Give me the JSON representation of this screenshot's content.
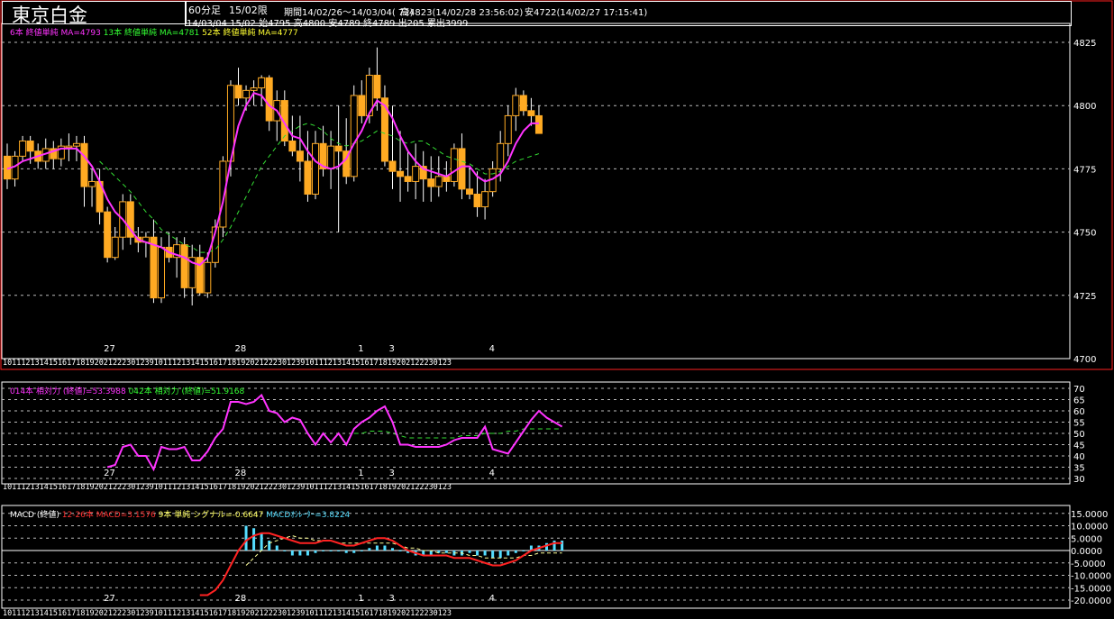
{
  "header": {
    "title": "東京白金",
    "period_tag": "60分足",
    "contract": "15/02限",
    "range": "期間14/02/26〜14/03/04( 72)",
    "high": "高4823(14/02/28 23:56:02)",
    "low": "安4722(14/02/27 17:15:41)",
    "last_bar": "14/03/04 15/02 始4795 高4800 安4789 終4789 出205 累出3999"
  },
  "legends": {
    "price": [
      {
        "text": "6本 終値単純 MA=4793",
        "color": "#ff33ff"
      },
      {
        "text": "13本 終値単純 MA=4781",
        "color": "#33ff33"
      },
      {
        "text": "52本 終値単純 MA=4777",
        "color": "#ffff33"
      }
    ],
    "rsi": [
      {
        "text": "014本 相対力 (終値)=53.3988",
        "color": "#ff33ff"
      },
      {
        "text": "042本 相対力 (終値)=51.9168",
        "color": "#33ff33"
      }
    ],
    "macd": [
      {
        "text": "MACD (終値)",
        "color": "#ffffff"
      },
      {
        "text": "12-26本 MACD=3.1576",
        "color": "#ff3333"
      },
      {
        "text": "9本 単純 シグナル=-0.6647",
        "color": "#ffff66"
      },
      {
        "text": "MACDｵｼﾚｰﾀｰ=3.8224",
        "color": "#55ddff"
      }
    ]
  },
  "axis": {
    "price_ticks": [
      "4825",
      "4800",
      "4775",
      "4750",
      "4725",
      "4700"
    ],
    "rsi_ticks": [
      "70",
      "65",
      "60",
      "55",
      "50",
      "45",
      "40",
      "35",
      "30"
    ],
    "macd_ticks": [
      "15.0000",
      "10.0000",
      "5.0000",
      "0.0000",
      "-5.0000",
      "-10.0000",
      "-15.0000",
      "-20.0000"
    ],
    "day_labels": [
      {
        "label": "27",
        "bar": 13
      },
      {
        "label": "28",
        "bar": 30
      },
      {
        "label": "1",
        "bar": 46
      },
      {
        "label": "3",
        "bar": 50
      },
      {
        "label": "4",
        "bar": 63
      }
    ],
    "hour_labels": [
      "1011121314151617181920212223",
      "0123910111213141516171819202122",
      "23012391011121314151617181920212223",
      "0123"
    ]
  },
  "chart_data": {
    "type": "candlestick",
    "price_ylim": [
      4700,
      4830
    ],
    "rsi_ylim": [
      30,
      70
    ],
    "macd_ylim": [
      -20,
      15
    ],
    "ohlc": [
      [
        4780,
        4785,
        4767,
        4771
      ],
      [
        4771,
        4782,
        4768,
        4780
      ],
      [
        4780,
        4788,
        4778,
        4786
      ],
      [
        4786,
        4788,
        4777,
        4782
      ],
      [
        4782,
        4785,
        4775,
        4778
      ],
      [
        4778,
        4787,
        4775,
        4783
      ],
      [
        4783,
        4786,
        4775,
        4779
      ],
      [
        4779,
        4787,
        4776,
        4784
      ],
      [
        4784,
        4789,
        4778,
        4784
      ],
      [
        4784,
        4788,
        4778,
        4785
      ],
      [
        4785,
        4788,
        4760,
        4768
      ],
      [
        4768,
        4775,
        4760,
        4770
      ],
      [
        4770,
        4775,
        4753,
        4758
      ],
      [
        4758,
        4760,
        4738,
        4740
      ],
      [
        4740,
        4752,
        4739,
        4748
      ],
      [
        4748,
        4765,
        4743,
        4762
      ],
      [
        4762,
        4765,
        4745,
        4748
      ],
      [
        4748,
        4752,
        4742,
        4746
      ],
      [
        4746,
        4750,
        4740,
        4748
      ],
      [
        4748,
        4755,
        4722,
        4724
      ],
      [
        4724,
        4748,
        4722,
        4744
      ],
      [
        4744,
        4750,
        4738,
        4740
      ],
      [
        4740,
        4748,
        4732,
        4745
      ],
      [
        4745,
        4748,
        4724,
        4728
      ],
      [
        4728,
        4745,
        4721,
        4740
      ],
      [
        4740,
        4745,
        4725,
        4726
      ],
      [
        4726,
        4742,
        4724,
        4738
      ],
      [
        4738,
        4755,
        4736,
        4752
      ],
      [
        4752,
        4780,
        4748,
        4778
      ],
      [
        4778,
        4810,
        4772,
        4808
      ],
      [
        4808,
        4815,
        4800,
        4803
      ],
      [
        4803,
        4808,
        4798,
        4806
      ],
      [
        4806,
        4810,
        4800,
        4807
      ],
      [
        4807,
        4812,
        4800,
        4811
      ],
      [
        4811,
        4812,
        4790,
        4794
      ],
      [
        4794,
        4806,
        4786,
        4802
      ],
      [
        4802,
        4806,
        4784,
        4786
      ],
      [
        4786,
        4796,
        4780,
        4782
      ],
      [
        4782,
        4796,
        4770,
        4778
      ],
      [
        4778,
        4790,
        4762,
        4765
      ],
      [
        4765,
        4790,
        4763,
        4785
      ],
      [
        4785,
        4792,
        4772,
        4775
      ],
      [
        4775,
        4790,
        4767,
        4784
      ],
      [
        4784,
        4800,
        4750,
        4782
      ],
      [
        4782,
        4795,
        4769,
        4772
      ],
      [
        4772,
        4808,
        4770,
        4804
      ],
      [
        4804,
        4810,
        4793,
        4796
      ],
      [
        4796,
        4815,
        4793,
        4812
      ],
      [
        4812,
        4823,
        4798,
        4803
      ],
      [
        4803,
        4808,
        4776,
        4778
      ],
      [
        4778,
        4800,
        4767,
        4774
      ],
      [
        4774,
        4790,
        4762,
        4772
      ],
      [
        4772,
        4782,
        4766,
        4770
      ],
      [
        4770,
        4785,
        4763,
        4776
      ],
      [
        4776,
        4782,
        4762,
        4771
      ],
      [
        4771,
        4780,
        4762,
        4768
      ],
      [
        4768,
        4780,
        4764,
        4772
      ],
      [
        4772,
        4778,
        4766,
        4770
      ],
      [
        4770,
        4785,
        4768,
        4783
      ],
      [
        4783,
        4789,
        4763,
        4767
      ],
      [
        4767,
        4776,
        4763,
        4765
      ],
      [
        4765,
        4774,
        4756,
        4760
      ],
      [
        4760,
        4771,
        4755,
        4766
      ],
      [
        4766,
        4778,
        4764,
        4775
      ],
      [
        4775,
        4790,
        4770,
        4785
      ],
      [
        4785,
        4800,
        4780,
        4796
      ],
      [
        4796,
        4807,
        4790,
        4804
      ],
      [
        4804,
        4806,
        4796,
        4798
      ],
      [
        4798,
        4803,
        4792,
        4796
      ],
      [
        4796,
        4800,
        4789,
        4789
      ]
    ],
    "ma6": [
      4775,
      4776,
      4778,
      4779,
      4780,
      4781,
      4782,
      4783,
      4783,
      4783,
      4780,
      4776,
      4770,
      4763,
      4758,
      4755,
      4751,
      4747,
      4746,
      4745,
      4744,
      4742,
      4741,
      4740,
      4738,
      4737,
      4740,
      4750,
      4762,
      4778,
      4792,
      4800,
      4805,
      4804,
      4800,
      4798,
      4793,
      4788,
      4787,
      4782,
      4778,
      4776,
      4775,
      4776,
      4779,
      4785,
      4790,
      4797,
      4802,
      4800,
      4795,
      4788,
      4782,
      4778,
      4775,
      4774,
      4773,
      4772,
      4774,
      4776,
      4776,
      4772,
      4770,
      4771,
      4773,
      4778,
      4785,
      4790,
      4793,
      4793
    ],
    "ma13": [
      null,
      null,
      null,
      null,
      null,
      null,
      null,
      null,
      null,
      null,
      null,
      null,
      4778,
      4775,
      4772,
      4769,
      4766,
      4762,
      4758,
      4755,
      4751,
      4749,
      4747,
      4745,
      4744,
      4742,
      4742,
      4743,
      4747,
      4752,
      4758,
      4764,
      4770,
      4776,
      4780,
      4784,
      4788,
      4790,
      4792,
      4793,
      4792,
      4790,
      4787,
      4785,
      4784,
      4785,
      4786,
      4788,
      4790,
      4789,
      4788,
      4786,
      4785,
      4786,
      4786,
      4784,
      4782,
      4780,
      4779,
      4778,
      4777,
      4775,
      4773,
      4773,
      4774,
      4776,
      4778,
      4779,
      4780,
      4781
    ],
    "rsi14": [
      null,
      null,
      null,
      null,
      null,
      null,
      null,
      null,
      null,
      null,
      null,
      null,
      null,
      35,
      36,
      44,
      45,
      40,
      40,
      34,
      44,
      43,
      43,
      44,
      38,
      38,
      42,
      48,
      52,
      64,
      64,
      63,
      64,
      67,
      60,
      59,
      55,
      57,
      56,
      50,
      45,
      50,
      46,
      50,
      45,
      52,
      55,
      57,
      60,
      62,
      55,
      45,
      45,
      44,
      44,
      44,
      44,
      45,
      47,
      48,
      48,
      48,
      53,
      43,
      42,
      41,
      46,
      51,
      56,
      60,
      57,
      55,
      53
    ],
    "rsi42": [
      null,
      null,
      null,
      null,
      null,
      null,
      null,
      null,
      null,
      null,
      null,
      null,
      null,
      null,
      null,
      null,
      null,
      null,
      null,
      null,
      null,
      null,
      null,
      null,
      null,
      null,
      null,
      null,
      null,
      null,
      null,
      null,
      null,
      null,
      null,
      null,
      null,
      null,
      null,
      null,
      null,
      null,
      null,
      null,
      null,
      50,
      50,
      51,
      51,
      51,
      50,
      49,
      48,
      48,
      48,
      48,
      48,
      48,
      48,
      49,
      49,
      49,
      50,
      50,
      50,
      51,
      51,
      52,
      52,
      52,
      52,
      52,
      52
    ],
    "macd": [
      null,
      null,
      null,
      null,
      null,
      null,
      null,
      null,
      null,
      null,
      null,
      null,
      null,
      null,
      null,
      null,
      null,
      null,
      null,
      null,
      null,
      null,
      null,
      null,
      null,
      -18,
      -18,
      -16,
      -12,
      -6,
      0,
      4,
      6,
      7,
      7,
      6,
      5,
      4,
      3,
      3,
      3,
      4,
      4,
      3,
      2,
      2,
      3,
      4,
      5,
      5,
      4,
      2,
      0,
      -1,
      -2,
      -2,
      -2,
      -2,
      -3,
      -3,
      -3,
      -4,
      -5,
      -6,
      -6,
      -5,
      -4,
      -2,
      0,
      1,
      2,
      3,
      3
    ],
    "signal": [
      null,
      null,
      null,
      null,
      null,
      null,
      null,
      null,
      null,
      null,
      null,
      null,
      null,
      null,
      null,
      null,
      null,
      null,
      null,
      null,
      null,
      null,
      null,
      null,
      null,
      null,
      null,
      null,
      null,
      null,
      null,
      -6,
      -3,
      0,
      3,
      4,
      5,
      6,
      5,
      5,
      4,
      4,
      4,
      3,
      3,
      3,
      3,
      3,
      3,
      3,
      3,
      2,
      1,
      1,
      0,
      0,
      -1,
      -1,
      -1,
      -1,
      -2,
      -2,
      -3,
      -3,
      -3,
      -3,
      -3,
      -2,
      -2,
      -1,
      -1,
      -1,
      -1
    ],
    "oscillator": [
      null,
      null,
      null,
      null,
      null,
      null,
      null,
      null,
      null,
      null,
      null,
      null,
      null,
      null,
      null,
      null,
      null,
      null,
      null,
      null,
      null,
      null,
      null,
      null,
      null,
      null,
      null,
      null,
      null,
      null,
      null,
      10,
      9,
      7,
      4,
      2,
      0,
      -2,
      -2,
      -2,
      -1,
      0,
      0,
      0,
      -1,
      -1,
      0,
      1,
      2,
      2,
      1,
      0,
      -1,
      -2,
      -2,
      -2,
      -1,
      -1,
      -2,
      -2,
      -1,
      -2,
      -2,
      -3,
      -3,
      -2,
      -1,
      0,
      2,
      2,
      3,
      4,
      4
    ]
  }
}
